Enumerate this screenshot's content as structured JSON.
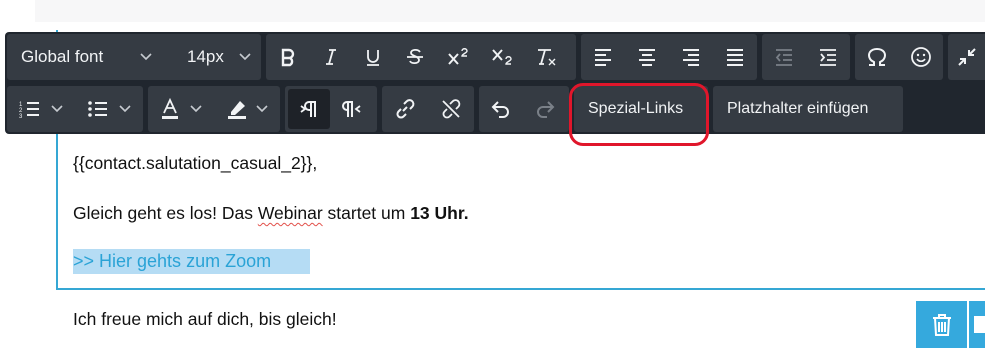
{
  "toolbar": {
    "font_family": "Global font",
    "font_size": "14px",
    "special_links": "Spezial-Links",
    "insert_placeholder": "Platzhalter einfügen"
  },
  "content": {
    "salutation": "{{contact.salutation_casual_2}},",
    "line_prefix": "Gleich geht es los! Das ",
    "line_word": "Webinar",
    "line_middle": " startet um ",
    "line_time": "13 Uhr.",
    "link_text": ">> Hier gehts zum Zoom",
    "closing": "Ich freue mich auf dich, bis gleich!"
  },
  "colors": {
    "toolbar_bg": "#20262e",
    "button_group_bg": "#353b43",
    "accent_blue": "#35a7d4",
    "link_highlight": "#b5dcf4",
    "callout_red": "#e0162b"
  }
}
